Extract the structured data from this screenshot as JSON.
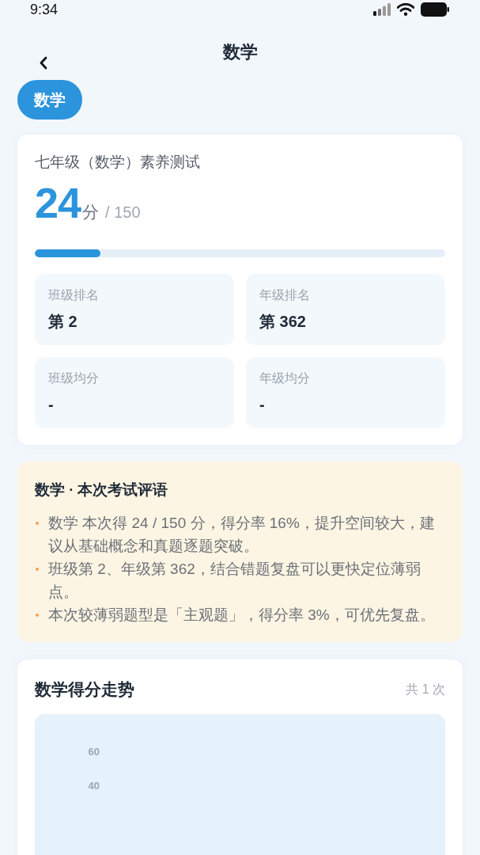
{
  "status_bar": {
    "time": "9:34"
  },
  "nav": {
    "title": "数学"
  },
  "subject_chip": {
    "label": "数学",
    "selected": true
  },
  "score_card": {
    "title": "七年级（数学）素养测试",
    "score": "24",
    "unit": "分",
    "total": "/ 150",
    "progress": {
      "level": 0.16
    },
    "stats": [
      {
        "label": "班级排名",
        "value": "第 2"
      },
      {
        "label": "年级排名",
        "value": "第 362"
      },
      {
        "label": "班级均分",
        "value": "-"
      },
      {
        "label": "年级均分",
        "value": "-"
      }
    ]
  },
  "comment_card": {
    "title": "数学 · 本次考试评语",
    "items": [
      "数学 本次得 24 / 150 分，得分率 16%，提升空间较大，建议从基础概念和真题逐题突破。",
      "班级第 2、年级第 362，结合错题复盘可以更快定位薄弱点。",
      "本次较薄弱题型是「主观题」，得分率 3%，可优先复盘。"
    ]
  },
  "trend_card": {
    "title": "数学得分走势",
    "count": "共 1 次",
    "y_tick_labels": [
      "60",
      "40"
    ]
  }
}
